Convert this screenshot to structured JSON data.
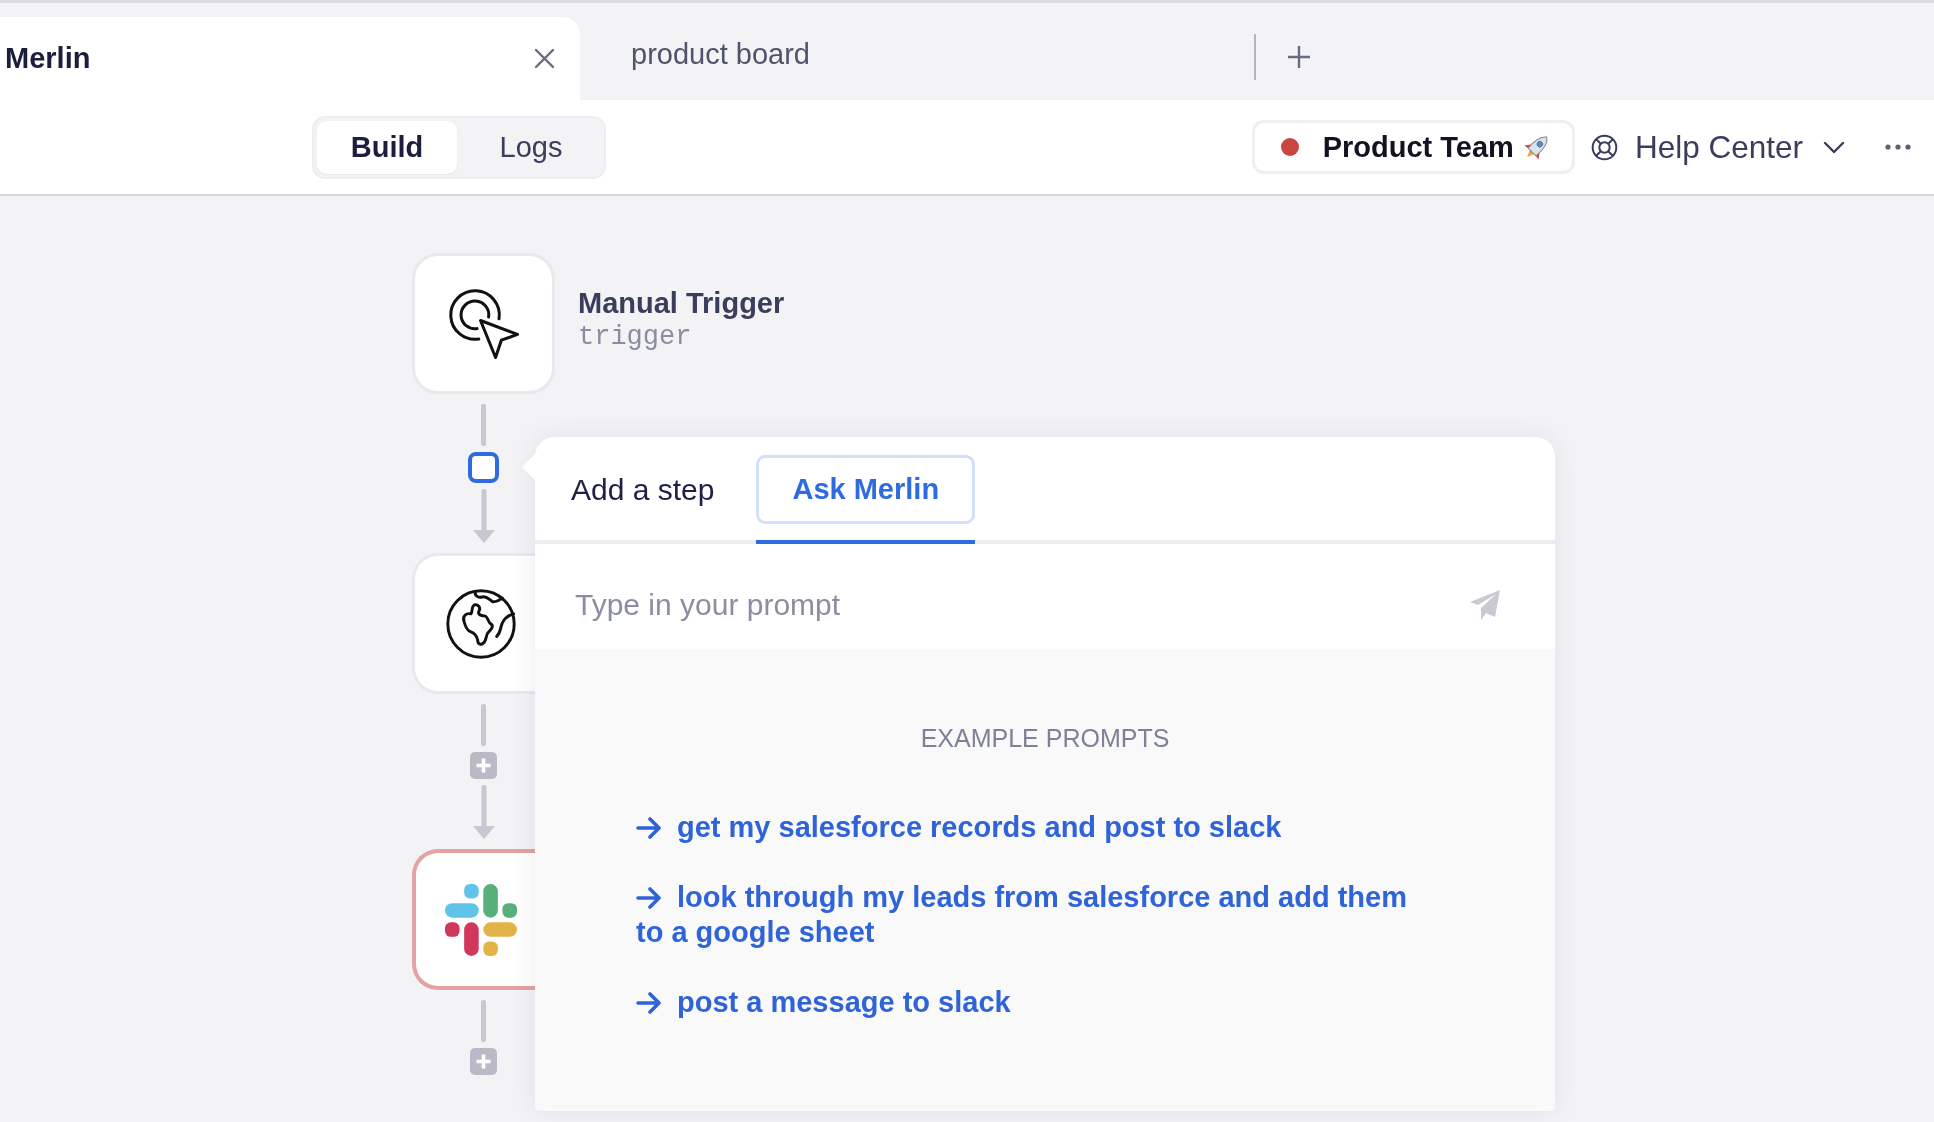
{
  "browser_tabs": [
    {
      "title": "Merlin",
      "selected": true
    },
    {
      "title": "product board",
      "selected": false
    }
  ],
  "toolbar": {
    "modes": [
      {
        "label": "Build",
        "selected": true
      },
      {
        "label": "Logs",
        "selected": false
      }
    ],
    "workspace": {
      "name": "Product Team",
      "color": "#c9453d"
    },
    "help": {
      "label": "Help Center"
    }
  },
  "workflow": {
    "nodes": [
      {
        "kind": "trigger",
        "title": "Manual Trigger",
        "subtitle": "trigger",
        "error": false,
        "insert_selected": true
      },
      {
        "kind": "web",
        "error": false,
        "insert_selected": false
      },
      {
        "kind": "slack",
        "error": true,
        "insert_selected": false
      }
    ]
  },
  "popover": {
    "tabs": [
      {
        "label": "Add a step",
        "selected": false
      },
      {
        "label": "Ask Merlin",
        "selected": true
      }
    ],
    "prompt": {
      "placeholder": "Type in your prompt"
    },
    "examples": {
      "heading": "EXAMPLE PROMPTS",
      "items": [
        "get my salesforce records and post to slack",
        "look through my leads from salesforce and add them to a google sheet",
        "post a message to slack"
      ]
    }
  }
}
